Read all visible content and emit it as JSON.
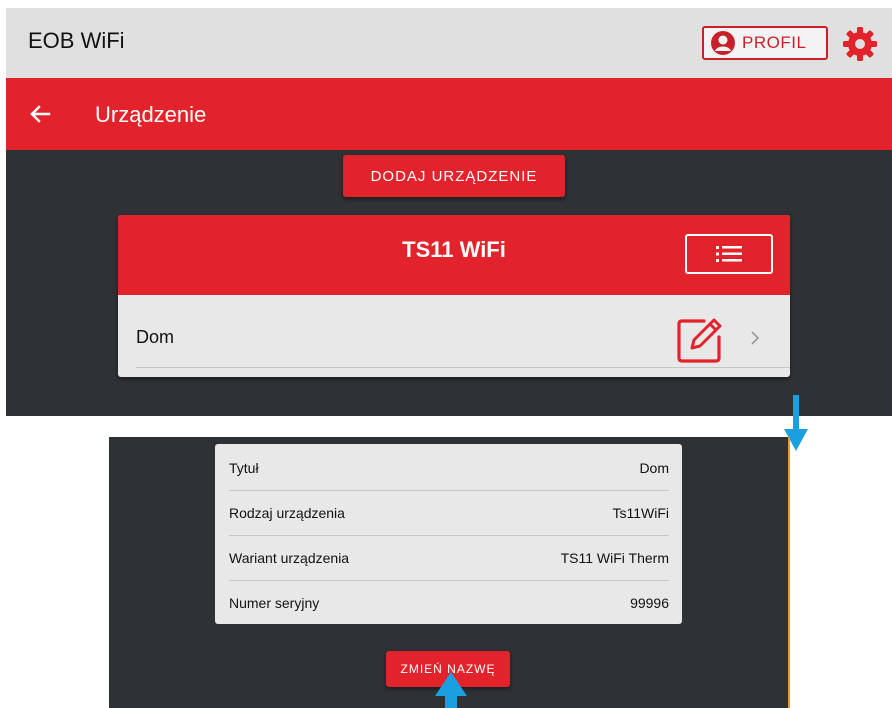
{
  "app": {
    "title": "EOB WiFi",
    "profile_label": "PROFIL"
  },
  "nav": {
    "page_title": "Urządzenie"
  },
  "actions": {
    "add_device_label": "DODAJ URZĄDZENIE",
    "rename_label": "ZMIEŃ NAZWĘ"
  },
  "device": {
    "title": "TS11 WiFi",
    "name": "Dom"
  },
  "details": {
    "rows": [
      {
        "label": "Tytuł",
        "value": "Dom"
      },
      {
        "label": "Rodzaj urządzenia",
        "value": "Ts11WiFi"
      },
      {
        "label": "Wariant urządzenia",
        "value": "TS11 WiFi Therm"
      },
      {
        "label": "Numer seryjny",
        "value": "99996"
      }
    ]
  },
  "colors": {
    "accent": "#e3232c",
    "dark_bg": "#2f3235",
    "card_bg": "#e8e8e8",
    "arrow": "#1aa0e0"
  },
  "icons": {
    "profile": "user-circle-icon",
    "settings": "gear-icon",
    "back": "arrow-left-icon",
    "menu": "list-icon",
    "edit": "edit-pencil-icon",
    "chevron": "chevron-right-icon"
  }
}
